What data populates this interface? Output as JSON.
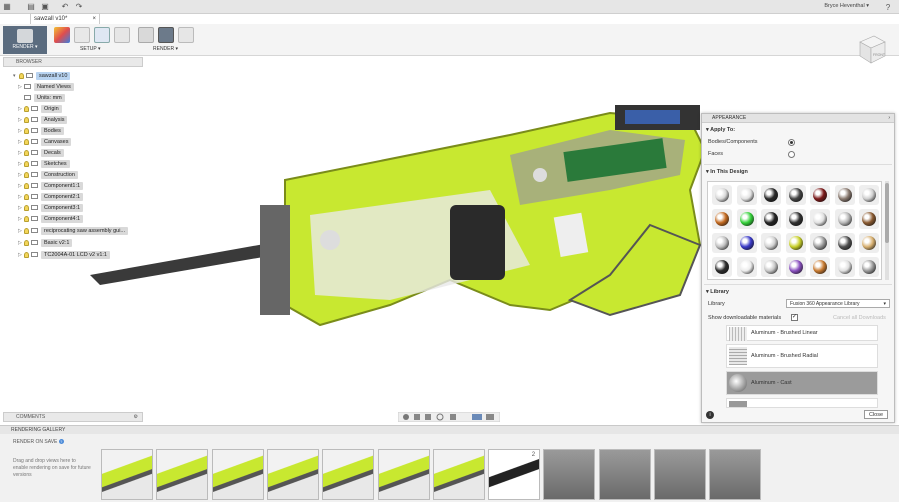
{
  "document": {
    "tab_title": "sawzall v10*"
  },
  "user": {
    "name": "Bryce Heventhal ▾"
  },
  "ribbon": {
    "workspace_label": "RENDER ▾",
    "setup_label": "SETUP ▾",
    "render_label": "RENDER ▾"
  },
  "browser": {
    "title": "BROWSER",
    "items": [
      {
        "label": "sawzall v10",
        "selected": true
      },
      {
        "label": "Named Views"
      },
      {
        "label": "Units: mm"
      },
      {
        "label": "Origin"
      },
      {
        "label": "Analysis"
      },
      {
        "label": "Bodies"
      },
      {
        "label": "Canvases"
      },
      {
        "label": "Decals"
      },
      {
        "label": "Sketches"
      },
      {
        "label": "Construction"
      },
      {
        "label": "Component1:1"
      },
      {
        "label": "Component2:1"
      },
      {
        "label": "Component3:1"
      },
      {
        "label": "Component4:1"
      },
      {
        "label": "reciprocating saw assembly gui..."
      },
      {
        "label": "Basic v2:1"
      },
      {
        "label": "TC2004A-01 LCD  v2 v1:1"
      }
    ]
  },
  "comments": {
    "title": "COMMENTS"
  },
  "appearance": {
    "title": "APPEARANCE",
    "apply_to": "Apply To:",
    "bodies_option": "Bodies/Components",
    "faces_option": "Faces",
    "in_design": "In This Design",
    "library_section": "Library",
    "library_label": "Library",
    "library_value": "Fusion 360 Appearance Library",
    "show_downloadable": "Show downloadable materials",
    "cancel_download": "Cancel all Downloads",
    "library_items": [
      {
        "name": "Aluminum - Brushed Linear"
      },
      {
        "name": "Aluminum - Brushed Radial"
      },
      {
        "name": "Aluminum - Cast",
        "selected": true
      },
      {
        "name": ""
      }
    ],
    "close_label": "Close",
    "swatch_colors": [
      "#d8d8d8",
      "#e2e2e2",
      "#2a2a2a",
      "#444444",
      "#7a1818",
      "#8a7a70",
      "#cfcfcf",
      "#c46a20",
      "#35d23a",
      "#222222",
      "#303030",
      "#e0e0e0",
      "#b8b8b8",
      "#8a5a30",
      "#c0c0c0",
      "#3a3ac8",
      "#d0d0d0",
      "#c8d02a",
      "#9a9a9a",
      "#505050",
      "#d8b070",
      "#2c2c2c",
      "#ececec",
      "#c8c8c8",
      "#8a50c0",
      "#c87a30",
      "#e0e0e0",
      "#9a9a9a"
    ]
  },
  "gallery": {
    "title": "RENDERING GALLERY",
    "render_on_save": "RENDER ON SAVE",
    "hint": "Drag and drop views here to enable rendering on save for future versions",
    "thumb_badge": "2"
  }
}
